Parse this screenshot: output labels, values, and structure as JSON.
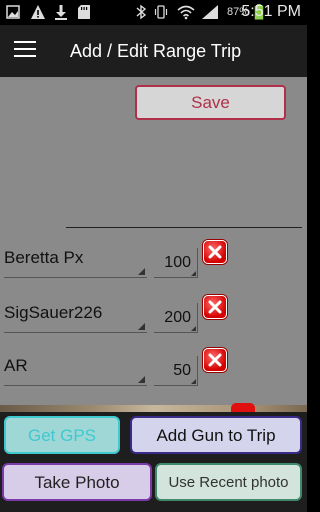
{
  "status_bar": {
    "battery_percent": "87%",
    "time": "5:51 PM"
  },
  "app_bar": {
    "title": "Add / Edit Range Trip"
  },
  "actions": {
    "save_label": "Save"
  },
  "guns": [
    {
      "name": "Beretta Px",
      "count": "100"
    },
    {
      "name": "SigSauer226",
      "count": "200"
    },
    {
      "name": "AR",
      "count": "50"
    }
  ],
  "bottom_buttons": {
    "get_gps": "Get GPS",
    "add_gun": "Add Gun to Trip",
    "take_photo": "Take Photo",
    "use_recent_photo": "Use Recent photo"
  },
  "colors": {
    "save_accent": "#b0304a",
    "gps_accent": "#3ec9d0",
    "add_gun_border": "#3a2a8a",
    "take_photo_border": "#7a3aa8",
    "recent_photo_border": "#3e8a6a",
    "delete_red": "#d40000"
  }
}
